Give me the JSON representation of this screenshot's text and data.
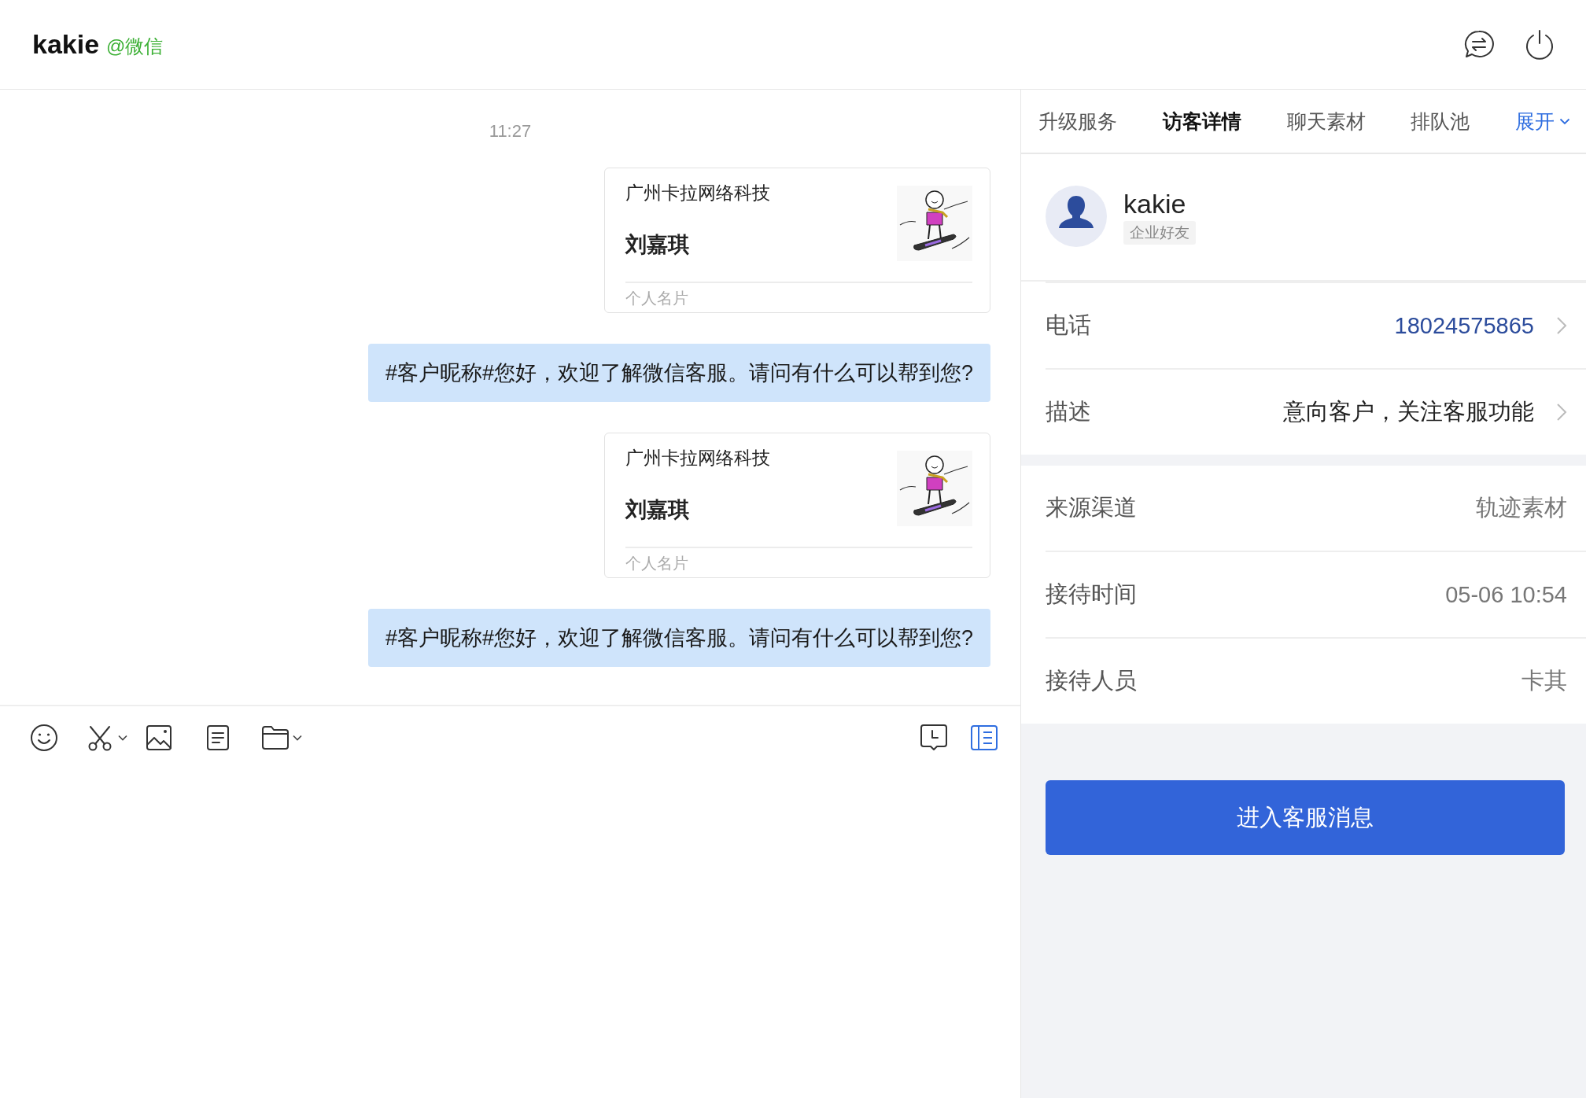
{
  "header": {
    "name": "kakie",
    "channel": "@微信"
  },
  "chat": {
    "time": "11:27",
    "messages": [
      {
        "kind": "card",
        "company": "广州卡拉网络科技",
        "name": "刘嘉琪",
        "footer": "个人名片"
      },
      {
        "kind": "text",
        "text": "#客户昵称#您好，欢迎了解微信客服。请问有什么可以帮到您?"
      },
      {
        "kind": "card",
        "company": "广州卡拉网络科技",
        "name": "刘嘉琪",
        "footer": "个人名片"
      },
      {
        "kind": "text",
        "text": "#客户昵称#您好，欢迎了解微信客服。请问有什么可以帮到您?"
      }
    ]
  },
  "toolbar": {
    "side_panel_open": true
  },
  "panel": {
    "tabs": [
      {
        "label": "升级服务",
        "kind": "tab",
        "selected": false
      },
      {
        "label": "访客详情",
        "kind": "tab",
        "selected": true
      },
      {
        "label": "聊天素材",
        "kind": "tab",
        "selected": false
      },
      {
        "label": "排队池",
        "kind": "tab",
        "selected": false
      },
      {
        "label": "展开",
        "kind": "expand",
        "selected": false
      }
    ],
    "profile": {
      "name": "kakie",
      "tag": "企业好友"
    },
    "groups": [
      [
        {
          "label": "电话",
          "value": "18024575865",
          "kind": "link"
        },
        {
          "label": "描述",
          "value": "意向客户，关注客服功能",
          "kind": "editable"
        }
      ],
      [
        {
          "label": "来源渠道",
          "value": "轨迹素材",
          "kind": "info"
        },
        {
          "label": "接待时间",
          "value": "05-06 10:54",
          "kind": "info"
        },
        {
          "label": "接待人员",
          "value": "卡其",
          "kind": "info"
        }
      ]
    ],
    "button": "进入客服消息"
  }
}
